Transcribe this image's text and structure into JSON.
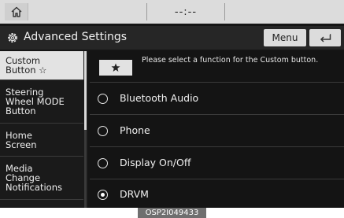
{
  "status_bar": {
    "clock": "--:--",
    "home_icon": "home-icon"
  },
  "title_bar": {
    "title": "Advanced Settings",
    "menu_label": "Menu",
    "settings_icon": "gear-icon",
    "back_icon": "back-arrow-icon"
  },
  "sidebar": {
    "items": [
      {
        "label": "Custom\nButton ☆",
        "active": true
      },
      {
        "label": "Steering\nWheel MODE\nButton",
        "active": false
      },
      {
        "label": "Home\nScreen",
        "active": false
      },
      {
        "label": "Media\nChange\nNotifications",
        "active": false
      }
    ]
  },
  "content": {
    "info_text": "Please select a function for the Custom button.",
    "star_icon": "star-icon",
    "options": [
      {
        "label": "Bluetooth Audio",
        "selected": false
      },
      {
        "label": "Phone",
        "selected": false
      },
      {
        "label": "Display On/Off",
        "selected": false
      },
      {
        "label": "DRVM",
        "selected": true
      }
    ]
  },
  "caption": "OSP2I049433",
  "colors": {
    "background": "#151515",
    "highlight": "#e3e3e3",
    "text": "#f0f0f0"
  }
}
